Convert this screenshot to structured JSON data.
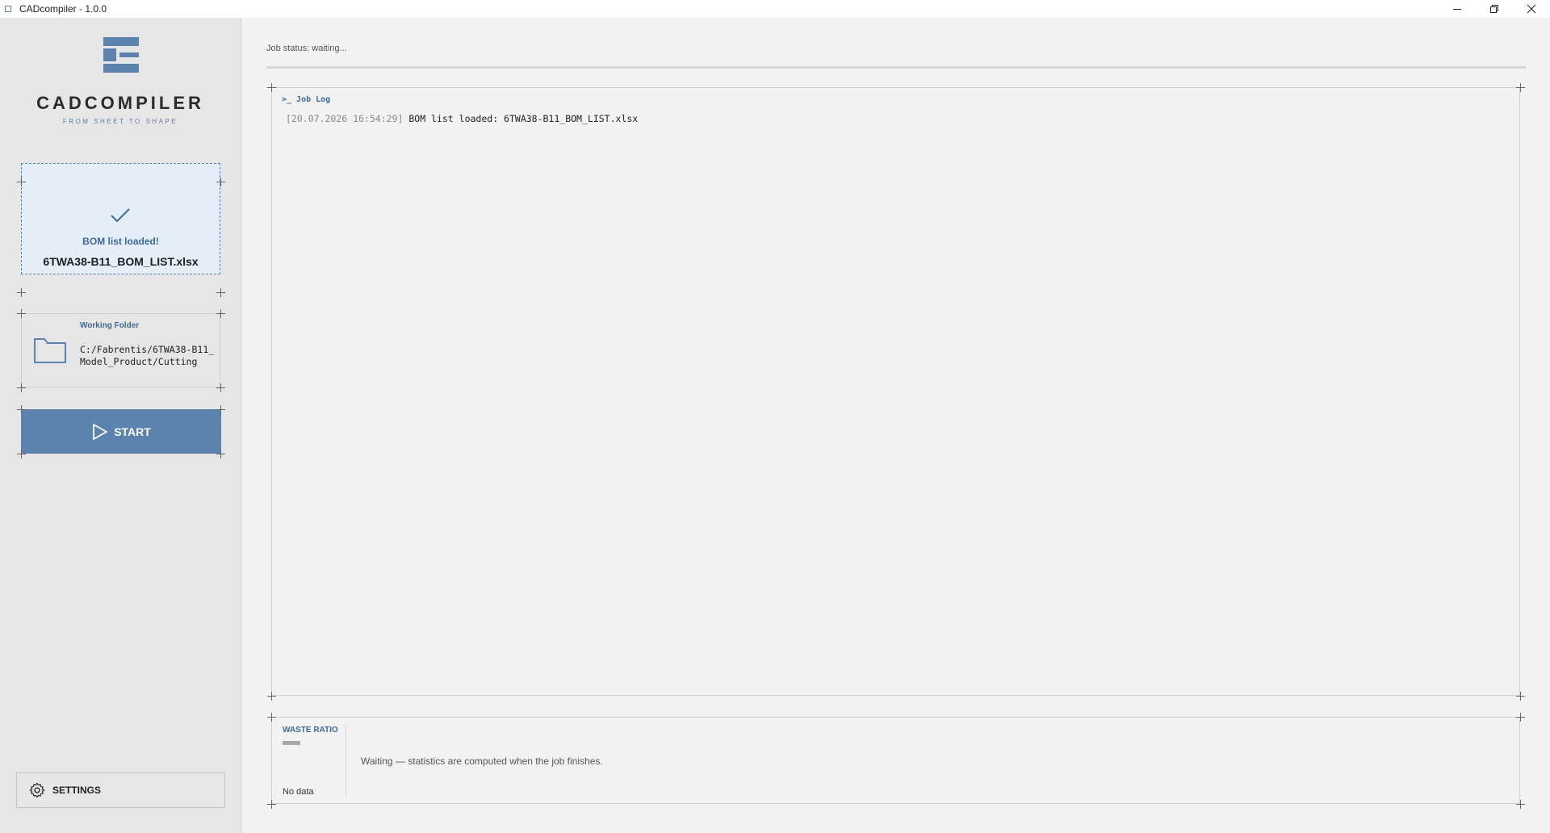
{
  "window": {
    "title": "CADcompiler - 1.0.0",
    "controls": [
      "minimize",
      "restore",
      "close"
    ]
  },
  "sidebar": {
    "logo_name": "CADCOMPILER",
    "logo_tagline": "FROM SHEET TO SHAPE",
    "bom": {
      "status": "BOM list loaded!",
      "filename": "6TWA38-B11_BOM_LIST.xlsx"
    },
    "folder": {
      "label": "Working Folder",
      "path": "C:/Fabrentis/6TWA38-B11_Model_Product/Cutting"
    },
    "start_label": "START",
    "settings_label": "SETTINGS"
  },
  "main": {
    "job_status": "Job status: waiting...",
    "progress": 0,
    "log": {
      "title": ">_ Job Log",
      "entries": [
        {
          "time": "[20.07.2026 16:54:29]",
          "message": "BOM list loaded: 6TWA38-B11_BOM_LIST.xlsx"
        }
      ]
    },
    "stats": {
      "waste_label": "WASTE RATIO",
      "no_data": "No data",
      "message": "Waiting — statistics are computed when the job finishes."
    }
  },
  "colors": {
    "accent": "#5b83ad",
    "accent_text": "#3f6a97",
    "bom_card_bg": "#e3eef9",
    "sidebar_bg": "#e6e6e6",
    "main_bg": "#f2f2f2"
  },
  "icons": [
    "app-icon",
    "minimize-icon",
    "restore-icon",
    "close-icon",
    "logo-icon",
    "check-icon",
    "folder-icon",
    "play-icon",
    "gear-icon"
  ]
}
